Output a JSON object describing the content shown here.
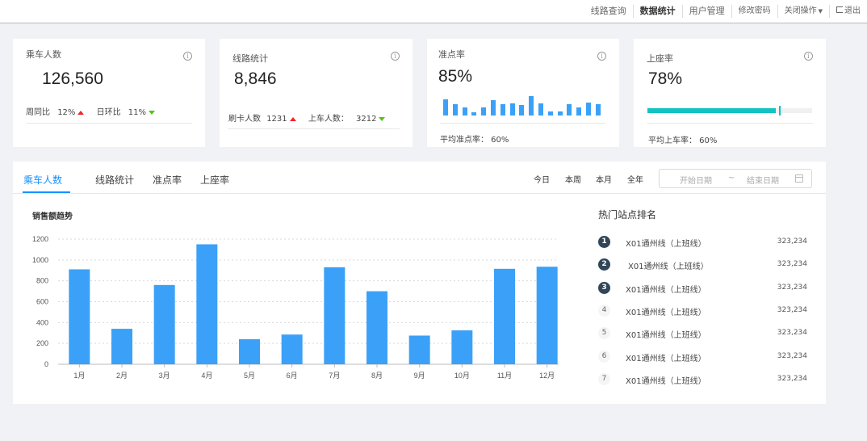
{
  "nav": {
    "items": [
      "线路查询",
      "数据统计",
      "用户管理",
      "修改密码",
      "关闭操作",
      "退出"
    ],
    "active": "数据统计"
  },
  "cards": {
    "passengers": {
      "title": "乘车人数",
      "value": "126,560",
      "wow_label": "周同比",
      "wow_value": "12%",
      "wow_trend": "up",
      "dod_label": "日环比",
      "dod_value": "11%",
      "dod_trend": "down"
    },
    "routes": {
      "title": "线路统计",
      "value": "8,846",
      "swipe_label": "刷卡人数",
      "swipe_value": "1231",
      "swipe_trend": "up",
      "board_label": "上车人数：",
      "board_value": "3212",
      "board_trend": "down"
    },
    "punctuality": {
      "title": "准点率",
      "value": "85%",
      "avg_text": "平均准点率： 60%",
      "bars": [
        18,
        13,
        9,
        4,
        9,
        17,
        13,
        14,
        12,
        22,
        14,
        5,
        5,
        13,
        9,
        15,
        13
      ]
    },
    "occupancy": {
      "title": "上座率",
      "value": "78%",
      "avg_text": "平均上车率： 60%",
      "progress": 0.78,
      "target": 0.8
    }
  },
  "tabs": [
    "乘车人数",
    "线路统计",
    "准点率",
    "上座率"
  ],
  "active_tab": "乘车人数",
  "ranges": [
    "今日",
    "本周",
    "本月",
    "全年"
  ],
  "date_picker": {
    "start_placeholder": "开始日期",
    "separator": "~",
    "end_placeholder": "结束日期"
  },
  "chart_title": "销售额趋势",
  "chart_data": {
    "type": "bar",
    "categories": [
      "1月",
      "2月",
      "3月",
      "4月",
      "5月",
      "6月",
      "7月",
      "8月",
      "9月",
      "10月",
      "11月",
      "12月"
    ],
    "values": [
      910,
      340,
      760,
      1150,
      240,
      285,
      930,
      700,
      275,
      325,
      915,
      935
    ],
    "yticks": [
      0,
      200,
      400,
      600,
      800,
      1000,
      1200
    ],
    "ylim": [
      0,
      1200
    ],
    "color": "#3ba1f8",
    "grid": true
  },
  "ranking": {
    "title": "热门站点排名",
    "items": [
      {
        "rank": "1",
        "name": "X01通州线（上班线）",
        "value": "323,234"
      },
      {
        "rank": "2",
        "name": "X01通州线（上班线）",
        "value": "323,234"
      },
      {
        "rank": "3",
        "name": "X01通州线（上班线）",
        "value": "323,234"
      },
      {
        "rank": "4",
        "name": "X01通州线（上班线）",
        "value": "323,234"
      },
      {
        "rank": "5",
        "name": "X01通州线（上班线）",
        "value": "323,234"
      },
      {
        "rank": "6",
        "name": "X01通州线（上班线）",
        "value": "323,234"
      },
      {
        "rank": "7",
        "name": "X01通州线（上班线）",
        "value": "323,234"
      }
    ]
  }
}
